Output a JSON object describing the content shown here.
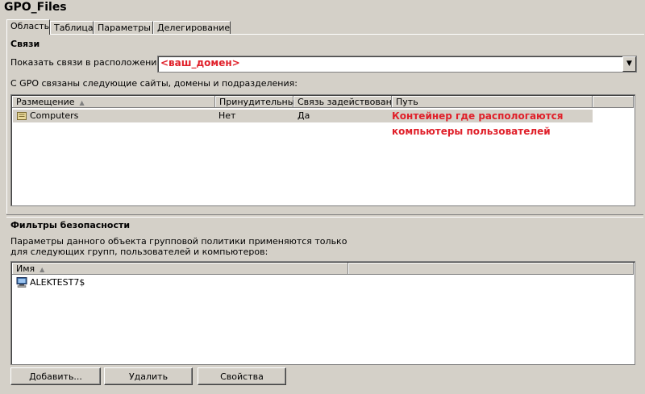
{
  "window": {
    "title": "GPO_Files"
  },
  "tabs": [
    {
      "label": "Область"
    },
    {
      "label": "Таблица"
    },
    {
      "label": "Параметры"
    },
    {
      "label": "Делегирование"
    }
  ],
  "links": {
    "section_title": "Связи",
    "location_label": "Показать связи в расположении:",
    "location_value": "<ваш_домен>",
    "description": "С GPO связаны следующие сайты, домены и подразделения:",
    "columns": [
      "Размещение",
      "Принудительный",
      "Связь задействована",
      "Путь"
    ],
    "rows": [
      {
        "location": "Computers",
        "enforced": "Нет",
        "enabled": "Да",
        "path": ""
      }
    ],
    "annotation_line1": "Контейнер где распологаются",
    "annotation_line2": "компьютеры пользователей"
  },
  "security": {
    "section_title": "Фильтры безопасности",
    "description_line1": "Параметры данного объекта групповой политики применяются только",
    "description_line2": "для следующих групп, пользователей и компьютеров:",
    "columns": [
      "Имя"
    ],
    "rows": [
      {
        "name": "ALEKTEST7$"
      }
    ]
  },
  "buttons": {
    "add": "Добавить...",
    "remove": "Удалить",
    "properties": "Свойства"
  },
  "icons": {
    "folder": "ou-folder-icon",
    "computer": "computer-icon",
    "sort": "sort-ascending-icon",
    "dropdown": "chevron-down-icon"
  },
  "colors": {
    "annotation": "#e0202a",
    "background": "#d4d0c8"
  }
}
